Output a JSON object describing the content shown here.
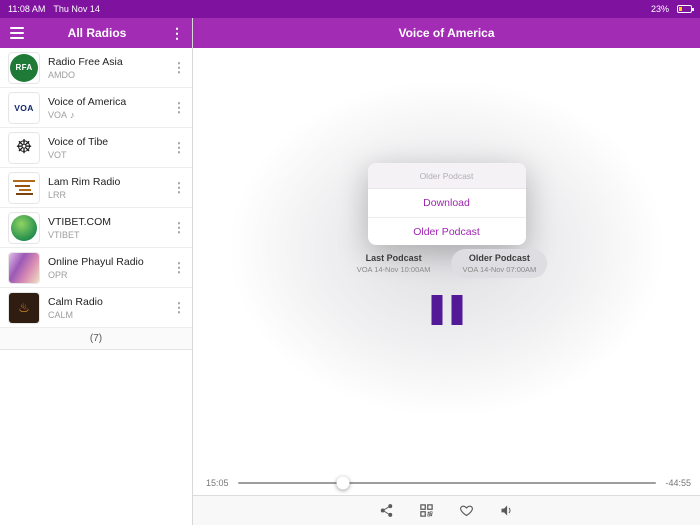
{
  "status_bar": {
    "time": "11:08 AM",
    "date": "Thu Nov 14",
    "battery": "23%"
  },
  "colors": {
    "accent": "#9c27b0",
    "header": "#a32cb5",
    "status_bar": "#8012a0",
    "pause_button": "#521a96"
  },
  "sidebar": {
    "title": "All Radios",
    "count": "(7)",
    "stations": [
      {
        "name": "Radio Free Asia",
        "code": "AMDO",
        "playing": false,
        "logo": {
          "shape": "circle",
          "text": "RFA",
          "bg": "#1f7a38",
          "fg": "#ffffff"
        }
      },
      {
        "name": "Voice of America",
        "code": "VOA",
        "playing": true,
        "logo": {
          "shape": "square",
          "text": "VOA",
          "bg": "#ffffff",
          "fg": "#12266b"
        }
      },
      {
        "name": "Voice of Tibe",
        "code": "VOT",
        "playing": false,
        "logo": {
          "shape": "glyph",
          "text": "☸",
          "bg": "#ffffff",
          "fg": "#1a1a1a"
        }
      },
      {
        "name": "Lam Rim Radio",
        "code": "LRR",
        "playing": false,
        "logo": {
          "shape": "script",
          "text": "",
          "bg": "#ffffff",
          "fg": "#a85b12"
        }
      },
      {
        "name": "VTIBET.COM",
        "code": "VTIBET",
        "playing": false,
        "logo": {
          "shape": "globe",
          "text": "",
          "bg": "radial-gradient(circle at 40% 35%, #8fd463 0%, #1f8a4c 75%)",
          "fg": "#ffffff"
        }
      },
      {
        "name": "Online Phayul Radio",
        "code": "OPR",
        "playing": false,
        "logo": {
          "shape": "banner",
          "text": "",
          "bg": "linear-gradient(120deg,#e3bfe8 0%,#9b59b6 35%,#d98cb3 65%,#efe0c2 100%)",
          "fg": "#ffffff"
        }
      },
      {
        "name": "Calm Radio",
        "code": "CALM",
        "playing": false,
        "logo": {
          "shape": "dark",
          "text": "♨",
          "bg": "#2f1d12",
          "fg": "#e8932c"
        }
      }
    ]
  },
  "main": {
    "title": "Voice of America",
    "popup": {
      "header": "Older Podcast",
      "options": [
        "Download",
        "Older Podcast"
      ]
    },
    "podcast_buttons": [
      {
        "title": "Last Podcast",
        "subtitle": "VOA 14-Nov 10:00AM",
        "selected": false
      },
      {
        "title": "Older Podcast",
        "subtitle": "VOA 14-Nov 07:00AM",
        "selected": true
      }
    ],
    "player": {
      "elapsed": "15:05",
      "remaining": "-44:55",
      "progress_percent": 25.2,
      "state": "playing"
    }
  }
}
